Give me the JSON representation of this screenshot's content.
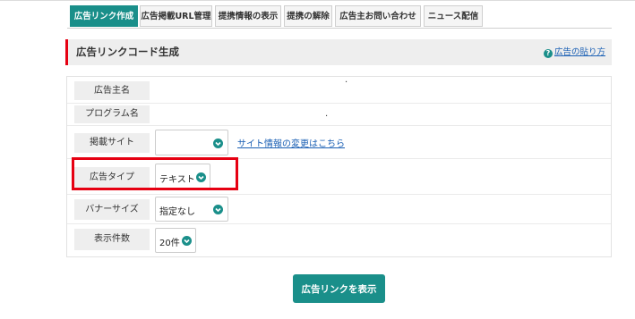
{
  "tabs": [
    {
      "label": "広告リンク作成",
      "active": true
    },
    {
      "label": "広告掲載URL管理",
      "active": false
    },
    {
      "label": "提携情報の表示",
      "active": false
    },
    {
      "label": "提携の解除",
      "active": false
    },
    {
      "label": "広告主お問い合わせ",
      "active": false
    },
    {
      "label": "ニュース配信",
      "active": false
    }
  ],
  "section": {
    "title": "広告リンクコード生成",
    "help_link": "広告の貼り方",
    "accent_color": "#e60012"
  },
  "form": {
    "advertiser_label": "広告主名",
    "advertiser_value": ".",
    "program_label": "プログラム名",
    "program_value": ".",
    "site_label": "掲載サイト",
    "site_value": "",
    "site_change_link": "サイト情報の変更はこちら",
    "ad_type_label": "広告タイプ",
    "ad_type_value": "テキスト",
    "banner_size_label": "バナーサイズ",
    "banner_size_value": "指定なし",
    "display_count_label": "表示件数",
    "display_count_value": "20件"
  },
  "submit_label": "広告リンクを表示",
  "colors": {
    "primary": "#1a8f8a",
    "highlight": "#e60012",
    "link": "#1a5fb4"
  },
  "icons": {
    "help": "question-circle-icon",
    "select": "chevron-down-icon"
  }
}
